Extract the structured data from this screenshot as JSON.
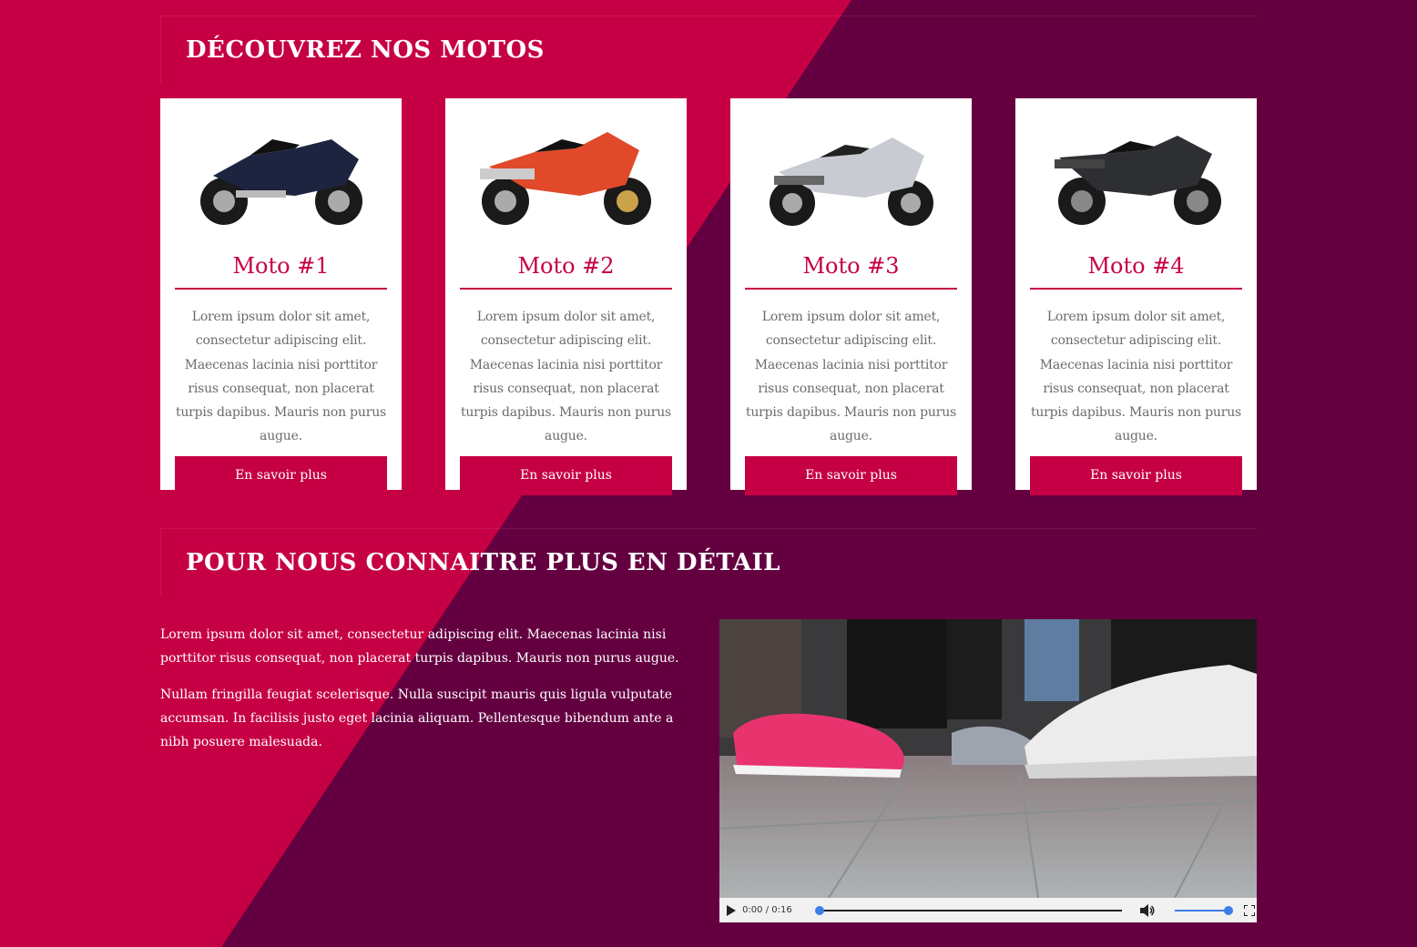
{
  "sections": {
    "motos_title": "DÉCOUVREZ NOS MOTOS",
    "about_title": "POUR NOUS CONNAITRE PLUS EN DÉTAIL"
  },
  "cards": [
    {
      "name": "Moto #1",
      "color": "#1c2440",
      "description": "Lorem ipsum dolor sit amet, consectetur adipiscing elit. Maecenas lacinia nisi porttitor risus consequat, non placerat turpis dapibus. Mauris non purus augue.",
      "button": "En savoir plus"
    },
    {
      "name": "Moto #2",
      "color": "#e04a2a",
      "description": "Lorem ipsum dolor sit amet, consectetur adipiscing elit. Maecenas lacinia nisi porttitor risus consequat, non placerat turpis dapibus. Mauris non purus augue.",
      "button": "En savoir plus"
    },
    {
      "name": "Moto #3",
      "color": "#c9cbd3",
      "description": "Lorem ipsum dolor sit amet, consectetur adipiscing elit. Maecenas lacinia nisi porttitor risus consequat, non placerat turpis dapibus. Mauris non purus augue.",
      "button": "En savoir plus"
    },
    {
      "name": "Moto #4",
      "color": "#2e2f33",
      "description": "Lorem ipsum dolor sit amet, consectetur adipiscing elit. Maecenas lacinia nisi porttitor risus consequat, non placerat turpis dapibus. Mauris non purus augue.",
      "button": "En savoir plus"
    }
  ],
  "about": {
    "paragraph1": "Lorem ipsum dolor sit amet, consectetur adipiscing elit. Maecenas lacinia nisi porttitor risus consequat, non placerat turpis dapibus. Mauris non purus augue.",
    "paragraph2": "Nullam fringilla feugiat scelerisque. Nulla suscipit mauris quis ligula vulputate accumsan. In facilisis justo eget lacinia aliquam. Pellentesque bibendum ante a nibh posuere malesuada."
  },
  "video": {
    "time": "0:00 / 0:16",
    "progress": 0,
    "volume": 1.0
  },
  "icons": {
    "play": "play-icon",
    "volume": "volume-icon",
    "fullscreen": "fullscreen-icon"
  },
  "colors": {
    "accent": "#c60044",
    "dark": "#640040",
    "progress": "#3b7de6"
  }
}
